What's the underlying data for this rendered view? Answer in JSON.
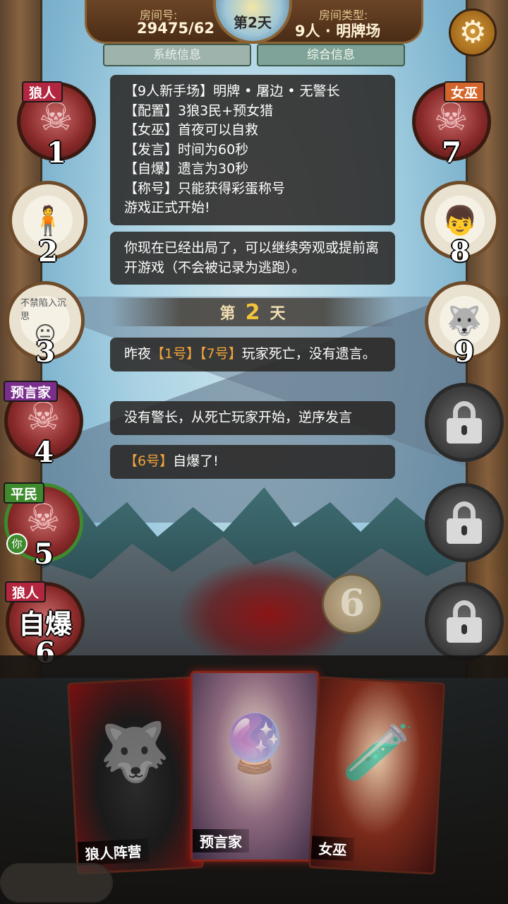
{
  "header": {
    "room_no_label": "房间号:",
    "room_no": "29475/62",
    "day_label": "第2天",
    "room_type_label": "房间类型:",
    "room_type": "9人 · 明牌场",
    "settings_icon": "gear-icon"
  },
  "tabs": [
    {
      "label": "系统信息"
    },
    {
      "label": "综合信息"
    }
  ],
  "messages": {
    "rules": [
      "【9人新手场】明牌 • 屠边 • 无警长",
      "【配置】3狼3民+预女猎",
      "【女巫】首夜可以自救",
      "【发言】时间为60秒",
      "【自爆】遗言为30秒",
      "【称号】只能获得彩蛋称号",
      "游戏正式开始!"
    ],
    "out_notice": "你现在已经出局了，可以继续旁观或提前离开游戏（不会被记录为逃跑）。",
    "day_divider": {
      "prefix": "第",
      "num": "2",
      "suffix": "天"
    },
    "death_prefix": "昨夜",
    "death_p1": "【1号】",
    "death_p2": "【7号】",
    "death_suffix": "玩家死亡，没有遗言。",
    "no_sheriff": "没有警长，从死亡玩家开始，逆序发言",
    "self_destruct_player": "【6号】",
    "self_destruct_suffix": "自爆了!"
  },
  "players": {
    "p1": {
      "num": "1",
      "role": "狼人"
    },
    "p2": {
      "num": "2"
    },
    "p3": {
      "num": "3",
      "avatar_caption": "不禁陷入沉思"
    },
    "p4": {
      "num": "4",
      "role": "预言家"
    },
    "p5": {
      "num": "5",
      "role": "平民",
      "you": "你"
    },
    "p6": {
      "num": "6",
      "role": "狼人",
      "status": "自爆"
    },
    "p7": {
      "num": "7",
      "role": "女巫"
    },
    "p8": {
      "num": "8"
    },
    "p9": {
      "num": "9"
    }
  },
  "scene_marker": "6",
  "cards": [
    {
      "label": "狼人阵营"
    },
    {
      "label": "预言家"
    },
    {
      "label": "女巫"
    }
  ],
  "colors": {
    "highlight": "#f3a43b",
    "wolf_tag": "#b3263f",
    "witch_tag": "#d4652a",
    "seer_tag": "#7a2f8c",
    "villager_tag": "#3e8a2d"
  }
}
